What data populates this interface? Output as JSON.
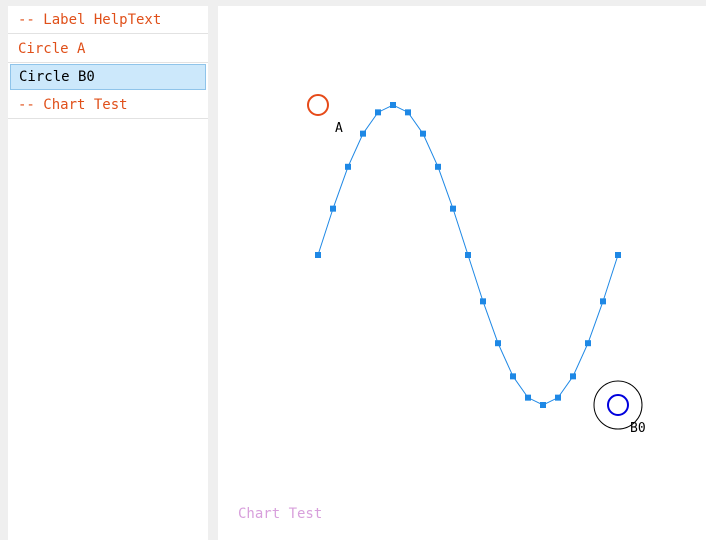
{
  "sidebar": {
    "items": [
      {
        "label": "-- Label HelpText",
        "kind": "section",
        "selected": false
      },
      {
        "label": "Circle A",
        "kind": "item",
        "selected": false
      },
      {
        "label": "Circle B0",
        "kind": "item",
        "selected": true
      },
      {
        "label": "-- Chart Test",
        "kind": "section",
        "selected": false
      }
    ]
  },
  "canvas": {
    "label_a": "A",
    "label_b0": "B0",
    "caption": "Chart Test",
    "colors": {
      "series": "#1e88e5",
      "circle_a": "#e64a19",
      "circle_b0_inner": "#0000dd",
      "circle_b0_outer": "#000000",
      "caption": "#d8a0dc"
    }
  },
  "chart_data": {
    "type": "line",
    "title": "",
    "xlabel": "",
    "ylabel": "",
    "series": [
      {
        "values": [
          0,
          0.309,
          0.588,
          0.809,
          0.951,
          1,
          0.951,
          0.809,
          0.588,
          0.309,
          0,
          -0.309,
          -0.588,
          -0.809,
          -0.951,
          -1,
          -0.951,
          -0.809,
          -0.588,
          -0.309,
          0
        ],
        "x": [
          0,
          1,
          2,
          3,
          4,
          5,
          6,
          7,
          8,
          9,
          10,
          11,
          12,
          13,
          14,
          15,
          16,
          17,
          18,
          19,
          20
        ]
      }
    ],
    "ylim": [
      -1,
      1
    ],
    "marker": "square",
    "axes_visible": false,
    "grid": false
  }
}
